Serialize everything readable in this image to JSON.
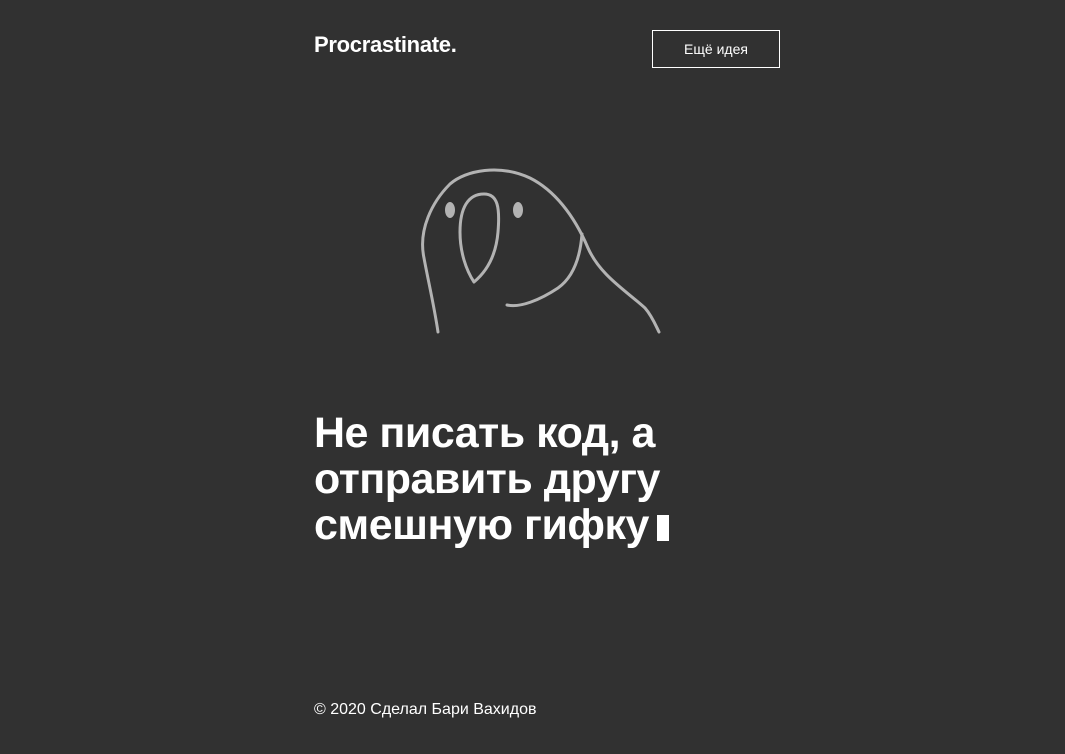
{
  "header": {
    "logo": "Procrastinate.",
    "more_idea_button": "Ещё идея"
  },
  "illustration": {
    "icon": "parrot-icon",
    "stroke_color": "#b3b3b3"
  },
  "main": {
    "headline_lines": [
      "Не писать код, а",
      "отправить другу",
      "смешную гифку"
    ]
  },
  "footer": {
    "copyright": "© 2020 Сделал Бари Вахидов"
  },
  "colors": {
    "background": "#313131",
    "text": "#ffffff"
  }
}
